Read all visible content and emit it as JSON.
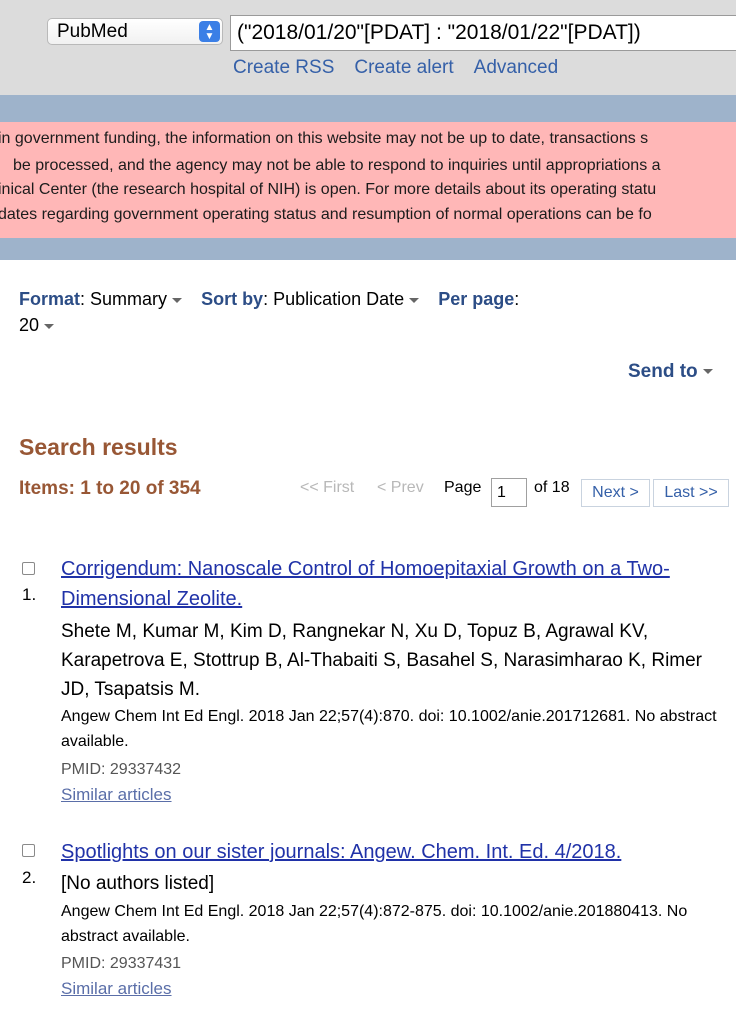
{
  "search": {
    "database": "PubMed",
    "query": "(\"2018/01/20\"[PDAT] : \"2018/01/22\"[PDAT])",
    "links": [
      "Create RSS",
      "Create alert",
      "Advanced"
    ]
  },
  "alert": {
    "lines": [
      " in government funding, the information on this website may not be up to date, transactions s",
      "be processed, and the agency may not be able to respond to inquiries until appropriations a",
      "inical Center (the research hospital of NIH) is open. For more details about its operating statu",
      "dates regarding government operating status and resumption of normal operations can be fo"
    ]
  },
  "display": {
    "format_label": "Format",
    "format_value": "Summary",
    "sort_label": "Sort by",
    "sort_value": "Publication Date",
    "perpage_label": "Per page",
    "perpage_value": "20",
    "send_to": "Send to"
  },
  "results": {
    "heading": "Search results",
    "items_text": "Items: 1 to 20 of 354",
    "pager": {
      "first": "<< First",
      "prev": "< Prev",
      "page_label": "Page",
      "page_value": "1",
      "of_text": "of 18",
      "next": "Next >",
      "last": "Last >>"
    },
    "items": [
      {
        "number": "1.",
        "title": "Corrigendum: Nanoscale Control of Homoepitaxial Growth on a Two-Dimensional Zeolite.",
        "authors": "Shete M, Kumar M, Kim D, Rangnekar N, Xu D, Topuz B, Agrawal KV, Karapetrova E, Stottrup B, Al-Thabaiti S, Basahel S, Narasimharao K, Rimer JD, Tsapatsis M.",
        "citation": "Angew Chem Int Ed Engl. 2018 Jan 22;57(4):870. doi: 10.1002/anie.201712681. No abstract available.",
        "pmid": "PMID: 29337432",
        "similar": "Similar articles"
      },
      {
        "number": "2.",
        "title": "Spotlights on our sister journals: Angew. Chem. Int. Ed. 4/2018.",
        "authors": "[No authors listed]",
        "citation": "Angew Chem Int Ed Engl. 2018 Jan 22;57(4):872-875. doi: 10.1002/anie.201880413. No abstract available.",
        "pmid": "PMID: 29337431",
        "similar": "Similar articles"
      }
    ]
  }
}
